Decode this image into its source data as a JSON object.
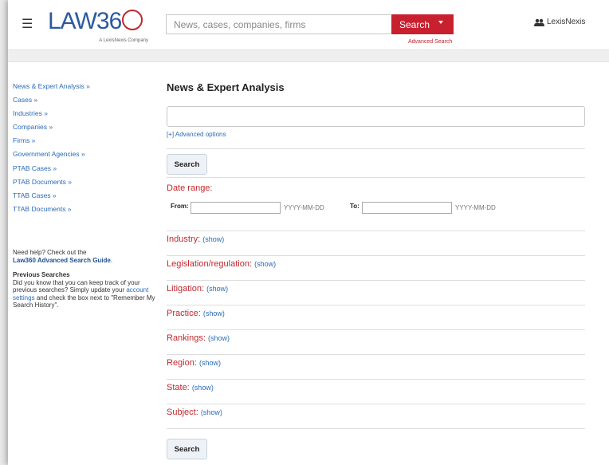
{
  "header": {
    "menu_icon": "hamburger-icon",
    "logo_text": "LAW360",
    "logo_pre": "LAW3",
    "logo_mid": "6",
    "logo_tagline": "A LexisNexis Company",
    "search_placeholder": "News, cases, companies, firms",
    "search_button": "Search",
    "advanced_search": "Advanced Search",
    "account_icon": "users-icon",
    "account_label": "LexisNexis"
  },
  "sidebar": {
    "links": [
      "News & Expert Analysis »",
      "Cases »",
      "Industries »",
      "Companies »",
      "Firms »",
      "Government Agencies »",
      "PTAB Cases »",
      "PTAB Documents »",
      "TTAB Cases »",
      "TTAB Documents »"
    ],
    "help_prefix": "Need help? Check out the",
    "help_link": "Law360 Advanced Search Guide",
    "help_suffix": ".",
    "previous_title": "Previous Searches",
    "previous_text_1": "Did you know that you can keep track of your previous searches? Simply update your",
    "previous_link": "account settings",
    "previous_text_2": "and check the box next to \"Remember My Search History\"."
  },
  "main": {
    "title": "News & Expert Analysis",
    "advanced_options": "[+] Advanced options",
    "search_button": "Search",
    "date_range_label": "Date range:",
    "from_label": "From:",
    "to_label": "To:",
    "date_hint": "YYYY-MM-DD",
    "show_label": "(show)",
    "facets": [
      "Industry:",
      "Legislation/regulation:",
      "Litigation:",
      "Practice:",
      "Rankings:",
      "Region:",
      "State:",
      "Subject:"
    ],
    "bottom_search_button": "Search"
  },
  "colors": {
    "brand_blue": "#2c5aa0",
    "brand_red": "#c8202f",
    "link_blue": "#2a6bb8"
  }
}
